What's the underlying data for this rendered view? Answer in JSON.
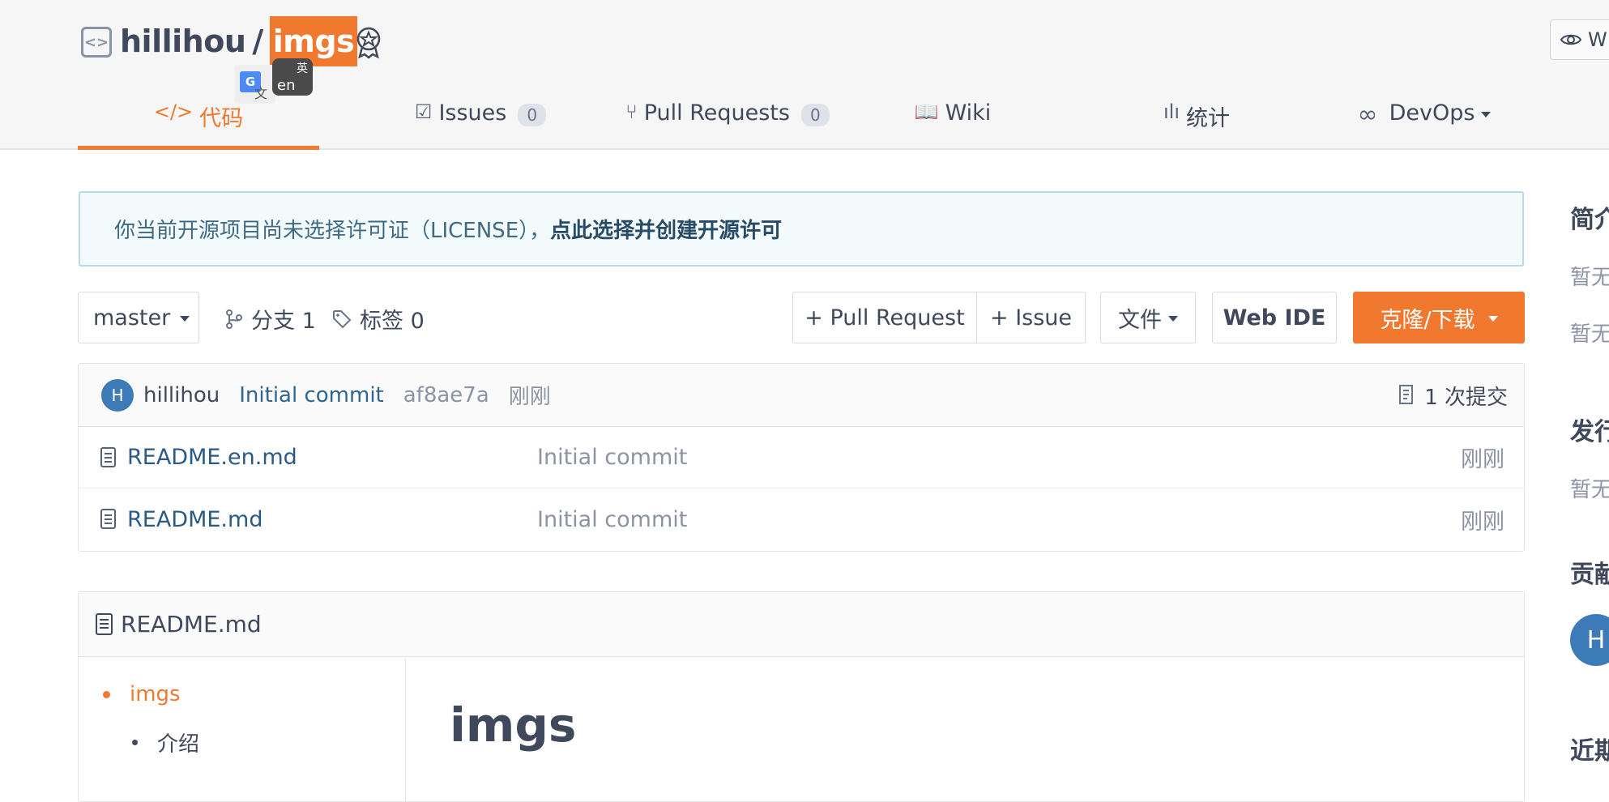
{
  "header": {
    "owner": "hillihou",
    "separator": "/",
    "repo": "imgs",
    "watch_label": "W",
    "translate_g": "G",
    "translate_wen": "文",
    "translate_ying": "英",
    "translate_en": "en"
  },
  "nav": {
    "code": "代码",
    "issues": "Issues",
    "issues_count": "0",
    "pull_requests": "Pull Requests",
    "pull_requests_count": "0",
    "wiki": "Wiki",
    "stats": "统计",
    "devops": "DevOps"
  },
  "notice": {
    "text": "你当前开源项目尚未选择许可证（LICENSE），",
    "link": "点此选择并创建开源许可"
  },
  "toolbar": {
    "branch": "master",
    "branches_label": "分支 1",
    "tags_label": "标签 0",
    "pull_request_btn": "+ Pull Request",
    "issue_btn": "+ Issue",
    "file_btn": "文件",
    "webide_btn": "Web IDE",
    "clone_btn": "克隆/下载"
  },
  "commit": {
    "avatar_letter": "H",
    "author": "hillihou",
    "message": "Initial commit",
    "sha": "af8ae7a",
    "time": "刚刚",
    "count": "1 次提交"
  },
  "files": [
    {
      "name": "README.en.md",
      "commit": "Initial commit",
      "time": "刚刚"
    },
    {
      "name": "README.md",
      "commit": "Initial commit",
      "time": "刚刚"
    }
  ],
  "readme": {
    "filename": "README.md",
    "toc": [
      "imgs",
      "介绍"
    ],
    "title": "imgs"
  },
  "sidebar": {
    "intro_heading": "简介",
    "intro_empty_1": "暂无",
    "intro_empty_2": "暂无",
    "release_heading": "发行",
    "release_empty": "暂无",
    "contrib_heading": "贡献",
    "contrib_avatar": "H",
    "recent_heading": "近期"
  },
  "colors": {
    "accent": "#f0792f",
    "link": "#2a5a85",
    "avatar": "#3d7ab8"
  }
}
